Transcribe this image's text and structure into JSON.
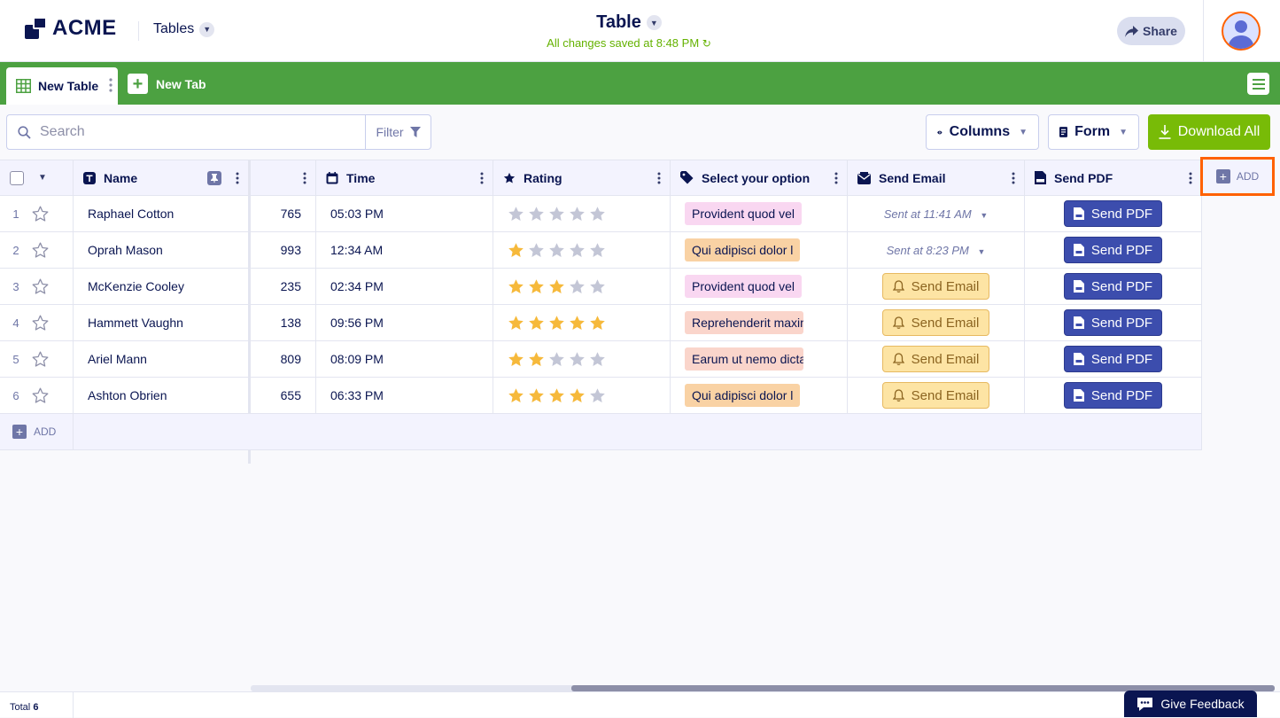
{
  "header": {
    "logo_text": "ACME",
    "tables_menu": "Tables",
    "title": "Table",
    "saved_status": "All changes saved at 8:48 PM",
    "share_label": "Share"
  },
  "tabs": {
    "active": "New Table",
    "new_tab": "New Tab"
  },
  "toolbar": {
    "search_placeholder": "Search",
    "filter_label": "Filter",
    "columns_label": "Columns",
    "form_label": "Form",
    "download_label": "Download All"
  },
  "columns": {
    "name": "Name",
    "time": "Time",
    "rating": "Rating",
    "select": "Select your option",
    "send_email": "Send Email",
    "send_pdf": "Send PDF",
    "add": "ADD"
  },
  "rows": [
    {
      "num": "1",
      "name": "Raphael Cotton",
      "number": "765",
      "time": "05:03 PM",
      "rating": 0,
      "option": "Provident quod vel",
      "option_color": "#f9d7f1",
      "email_sent": true,
      "email_text": "Sent at 11:41 AM",
      "pdf_label": "Send PDF"
    },
    {
      "num": "2",
      "name": "Oprah Mason",
      "number": "993",
      "time": "12:34 AM",
      "rating": 1,
      "option": "Qui adipisci dolor l",
      "option_color": "#f9d2a4",
      "email_sent": true,
      "email_text": "Sent at 8:23 PM",
      "pdf_label": "Send PDF"
    },
    {
      "num": "3",
      "name": "McKenzie Cooley",
      "number": "235",
      "time": "02:34 PM",
      "rating": 3,
      "option": "Provident quod vel",
      "option_color": "#f9d7f1",
      "email_sent": false,
      "email_text": "Send Email",
      "pdf_label": "Send PDF"
    },
    {
      "num": "4",
      "name": "Hammett Vaughn",
      "number": "138",
      "time": "09:56 PM",
      "rating": 5,
      "option": "Reprehenderit maxime",
      "option_color": "#fad5cb",
      "email_sent": false,
      "email_text": "Send Email",
      "pdf_label": "Send PDF"
    },
    {
      "num": "5",
      "name": "Ariel Mann",
      "number": "809",
      "time": "08:09 PM",
      "rating": 2,
      "option": "Earum ut nemo dicta",
      "option_color": "#fad5cb",
      "email_sent": false,
      "email_text": "Send Email",
      "pdf_label": "Send PDF"
    },
    {
      "num": "6",
      "name": "Ashton Obrien",
      "number": "655",
      "time": "06:33 PM",
      "rating": 4,
      "option": "Qui adipisci dolor l",
      "option_color": "#f9d2a4",
      "email_sent": false,
      "email_text": "Send Email",
      "pdf_label": "Send PDF"
    }
  ],
  "add_row_label": "ADD",
  "footer": {
    "total_label": "Total",
    "total_count": "6",
    "feedback_label": "Give Feedback"
  },
  "colors": {
    "brand_green": "#4ca141",
    "download_green": "#78bb07",
    "navy": "#0a1551",
    "pdf_blue": "#3c4dad",
    "highlight_orange": "#ff6100",
    "star_filled": "#f6b93b",
    "star_empty": "#c3c6d6"
  },
  "icons": [
    "logo-icon",
    "chevron-down-icon",
    "refresh-icon",
    "share-icon",
    "avatar-icon",
    "table-icon",
    "plus-icon",
    "menu-icon",
    "search-icon",
    "filter-icon",
    "eye-icon",
    "form-icon",
    "download-icon",
    "text-type-icon",
    "pin-icon",
    "kebab-icon",
    "calendar-icon",
    "star-icon",
    "tag-icon",
    "email-icon",
    "pdf-icon",
    "bell-icon",
    "feedback-icon"
  ]
}
